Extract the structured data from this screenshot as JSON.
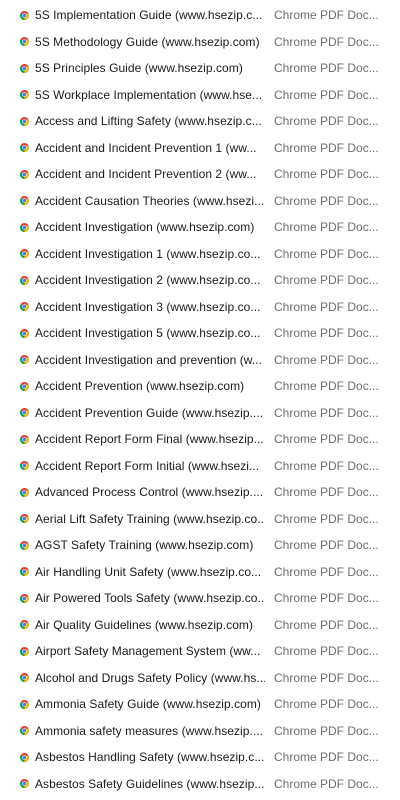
{
  "files": [
    {
      "name": "5S Implementation Guide (www.hsezip.c...",
      "type": "Chrome PDF Doc...",
      "icon": "chrome-pdf-icon"
    },
    {
      "name": "5S Methodology Guide (www.hsezip.com)",
      "type": "Chrome PDF Doc...",
      "icon": "chrome-pdf-icon"
    },
    {
      "name": "5S Principles Guide (www.hsezip.com)",
      "type": "Chrome PDF Doc...",
      "icon": "chrome-pdf-icon"
    },
    {
      "name": "5S Workplace Implementation (www.hse...",
      "type": "Chrome PDF Doc...",
      "icon": "chrome-pdf-icon"
    },
    {
      "name": "Access and Lifting Safety (www.hsezip.c...",
      "type": "Chrome PDF Doc...",
      "icon": "chrome-pdf-icon"
    },
    {
      "name": "Accident and Incident Prevention 1 (ww...",
      "type": "Chrome PDF Doc...",
      "icon": "chrome-pdf-icon"
    },
    {
      "name": "Accident and Incident Prevention 2 (ww...",
      "type": "Chrome PDF Doc...",
      "icon": "chrome-pdf-icon"
    },
    {
      "name": "Accident Causation Theories (www.hsezi...",
      "type": "Chrome PDF Doc...",
      "icon": "chrome-pdf-icon"
    },
    {
      "name": "Accident Investigation (www.hsezip.com)",
      "type": "Chrome PDF Doc...",
      "icon": "chrome-pdf-icon"
    },
    {
      "name": "Accident Investigation 1 (www.hsezip.co...",
      "type": "Chrome PDF Doc...",
      "icon": "chrome-pdf-icon"
    },
    {
      "name": "Accident Investigation 2 (www.hsezip.co...",
      "type": "Chrome PDF Doc...",
      "icon": "chrome-pdf-icon"
    },
    {
      "name": "Accident Investigation 3 (www.hsezip.co...",
      "type": "Chrome PDF Doc...",
      "icon": "chrome-pdf-icon"
    },
    {
      "name": "Accident Investigation 5 (www.hsezip.co...",
      "type": "Chrome PDF Doc...",
      "icon": "chrome-pdf-icon"
    },
    {
      "name": "Accident Investigation and prevention (w...",
      "type": "Chrome PDF Doc...",
      "icon": "chrome-pdf-icon"
    },
    {
      "name": "Accident Prevention (www.hsezip.com)",
      "type": "Chrome PDF Doc...",
      "icon": "chrome-pdf-icon"
    },
    {
      "name": "Accident Prevention Guide (www.hsezip....",
      "type": "Chrome PDF Doc...",
      "icon": "chrome-pdf-icon"
    },
    {
      "name": "Accident Report Form Final (www.hsezip...",
      "type": "Chrome PDF Doc...",
      "icon": "chrome-pdf-icon"
    },
    {
      "name": "Accident Report Form Initial (www.hsezi...",
      "type": "Chrome PDF Doc...",
      "icon": "chrome-pdf-icon"
    },
    {
      "name": "Advanced Process Control (www.hsezip....",
      "type": "Chrome PDF Doc...",
      "icon": "chrome-pdf-icon"
    },
    {
      "name": "Aerial Lift Safety Training (www.hsezip.co...",
      "type": "Chrome PDF Doc...",
      "icon": "chrome-pdf-icon"
    },
    {
      "name": "AGST Safety Training (www.hsezip.com)",
      "type": "Chrome PDF Doc...",
      "icon": "chrome-pdf-icon"
    },
    {
      "name": "Air Handling Unit Safety (www.hsezip.co...",
      "type": "Chrome PDF Doc...",
      "icon": "chrome-pdf-icon"
    },
    {
      "name": "Air Powered Tools Safety (www.hsezip.co...",
      "type": "Chrome PDF Doc...",
      "icon": "chrome-pdf-icon"
    },
    {
      "name": "Air Quality Guidelines (www.hsezip.com)",
      "type": "Chrome PDF Doc...",
      "icon": "chrome-pdf-icon"
    },
    {
      "name": "Airport Safety Management System (ww...",
      "type": "Chrome PDF Doc...",
      "icon": "chrome-pdf-icon"
    },
    {
      "name": "Alcohol and Drugs Safety Policy (www.hs...",
      "type": "Chrome PDF Doc...",
      "icon": "chrome-pdf-icon"
    },
    {
      "name": "Ammonia Safety Guide (www.hsezip.com)",
      "type": "Chrome PDF Doc...",
      "icon": "chrome-pdf-icon"
    },
    {
      "name": "Ammonia safety measures (www.hsezip....",
      "type": "Chrome PDF Doc...",
      "icon": "chrome-pdf-icon"
    },
    {
      "name": "Asbestos Handling Safety (www.hsezip.c...",
      "type": "Chrome PDF Doc...",
      "icon": "chrome-pdf-icon"
    },
    {
      "name": "Asbestos Safety Guidelines (www.hsezip...",
      "type": "Chrome PDF Doc...",
      "icon": "chrome-pdf-icon"
    }
  ],
  "colors": {
    "chrome_red": "#db4437",
    "chrome_yellow": "#f4b400",
    "chrome_green": "#0f9d58",
    "chrome_blue": "#4285f4",
    "name_text": "#1a1a1a",
    "type_text": "#6d6d6d"
  }
}
